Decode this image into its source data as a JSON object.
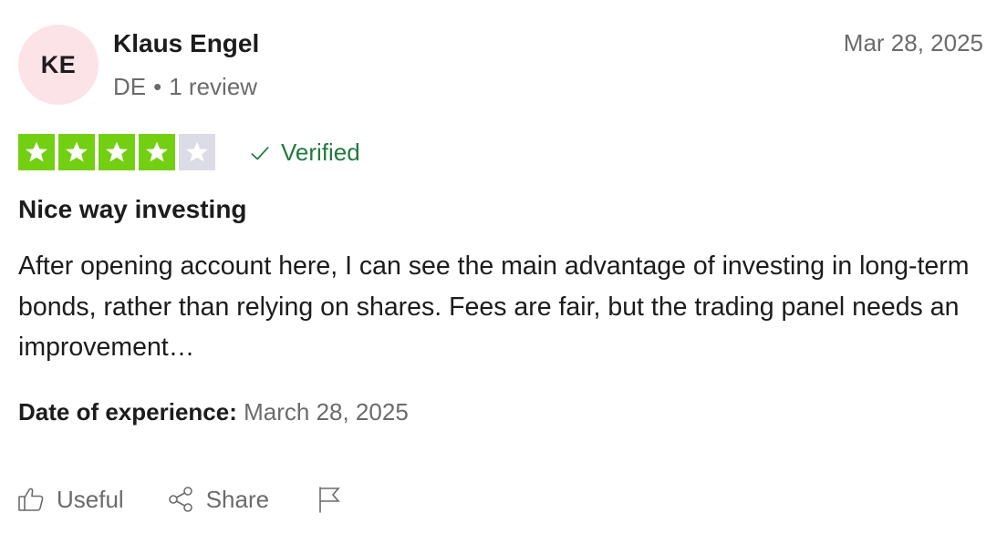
{
  "reviewer": {
    "initials": "KE",
    "name": "Klaus Engel",
    "country": "DE",
    "separator": "•",
    "review_count": "1 review",
    "avatar_color": "#fbe3e8"
  },
  "review": {
    "date": "Mar 28, 2025",
    "rating": 4,
    "rating_max": 5,
    "star_fill_color": "#73cf11",
    "star_empty_color": "#dcdce6",
    "verified_label": "Verified",
    "verified_color": "#217a3c",
    "title": "Nice way investing",
    "body": "After opening account here, I can see the main advantage of investing in long-term bonds, rather than relying on shares. Fees are fair, but the trading panel needs an improvement…",
    "experience_label": "Date of experience:",
    "experience_date": "March 28, 2025"
  },
  "actions": {
    "useful_label": "Useful",
    "useful_icon": "thumbs-up-icon",
    "share_label": "Share",
    "share_icon": "share-icon",
    "report_icon": "flag-icon"
  }
}
